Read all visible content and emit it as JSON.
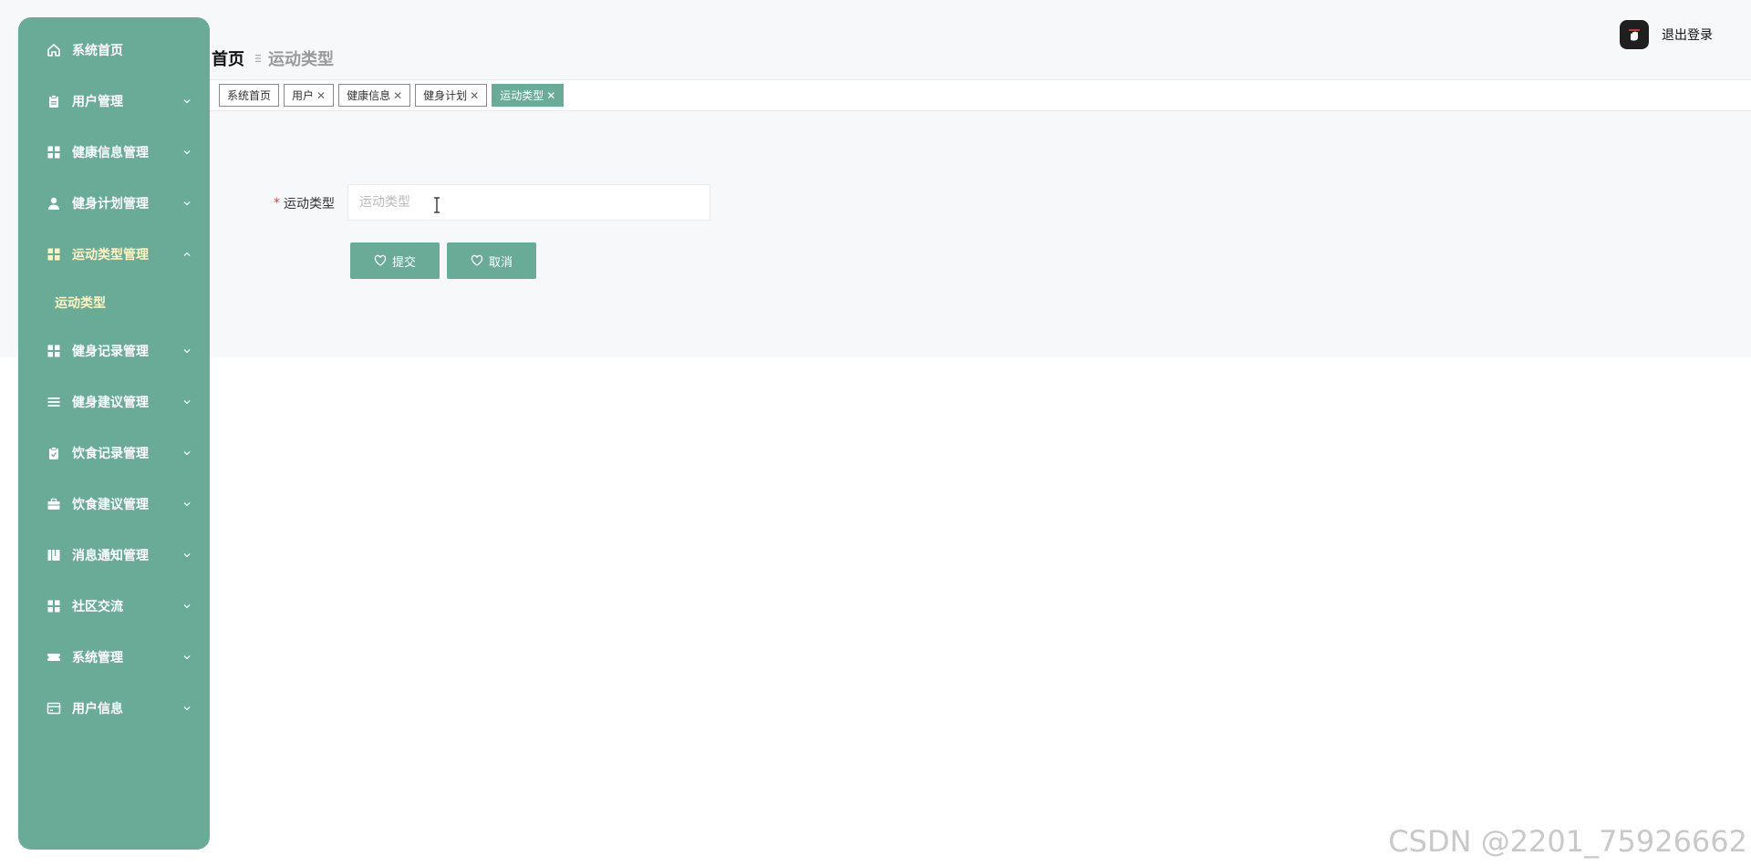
{
  "sidebar": {
    "items": [
      {
        "label": "系统首页",
        "icon": "home-icon"
      },
      {
        "label": "用户管理",
        "icon": "clipboard-icon"
      },
      {
        "label": "健康信息管理",
        "icon": "grid-icon"
      },
      {
        "label": "健身计划管理",
        "icon": "user-icon"
      },
      {
        "label": "运动类型管理",
        "icon": "grid-icon",
        "expanded": true
      },
      {
        "label": "健身记录管理",
        "icon": "grid-icon"
      },
      {
        "label": "健身建议管理",
        "icon": "list-icon"
      },
      {
        "label": "饮食记录管理",
        "icon": "clipboard-check-icon"
      },
      {
        "label": "饮食建议管理",
        "icon": "briefcase-icon"
      },
      {
        "label": "消息通知管理",
        "icon": "book-icon"
      },
      {
        "label": "社区交流",
        "icon": "grid-icon"
      },
      {
        "label": "系统管理",
        "icon": "ticket-icon"
      },
      {
        "label": "用户信息",
        "icon": "card-icon"
      }
    ],
    "submenu": {
      "label": "运动类型"
    }
  },
  "header": {
    "breadcrumb_home": "首页",
    "breadcrumb_current": "运动类型",
    "logout": "退出登录"
  },
  "tags": [
    {
      "label": "系统首页",
      "closable": false
    },
    {
      "label": "用户",
      "closable": true
    },
    {
      "label": "健康信息",
      "closable": true
    },
    {
      "label": "健身计划",
      "closable": true
    },
    {
      "label": "运动类型",
      "closable": true,
      "active": true
    }
  ],
  "form": {
    "field_label": "运动类型",
    "required_mark": "*",
    "placeholder": "运动类型",
    "value": "",
    "submit": "提交",
    "cancel": "取消"
  },
  "watermark": "CSDN @2201_75926662",
  "colors": {
    "accent": "#6aab97",
    "active_text": "#fff3c2",
    "required": "#e64242"
  }
}
